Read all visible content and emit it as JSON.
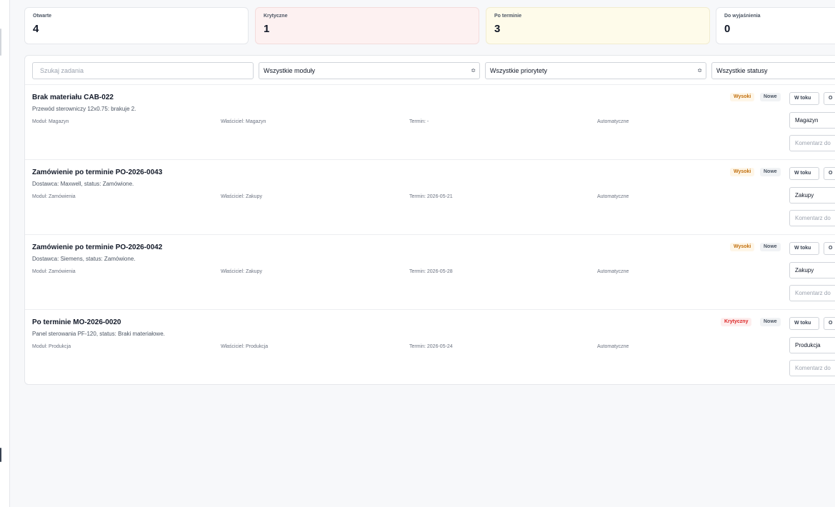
{
  "stats": [
    {
      "label": "Otwarte",
      "value": "4"
    },
    {
      "label": "Krytyczne",
      "value": "1"
    },
    {
      "label": "Po terminie",
      "value": "3"
    },
    {
      "label": "Do wyjaśnienia",
      "value": "0"
    }
  ],
  "filters": {
    "search_placeholder": "Szukaj zadania",
    "module": "Wszystkie moduły",
    "priority": "Wszystkie priorytety",
    "status": "Wszystkie statusy",
    "arrows": "≎"
  },
  "tasks": [
    {
      "title": "Brak materiału CAB-022",
      "description": "Przewód sterowniczy 12x0.75: brakuje 2.",
      "module": "Moduł: Magazyn",
      "owner": "Właściciel: Magazyn",
      "deadline": "Termin: -",
      "source": "Automatyczne",
      "priority": "Wysoki",
      "status": "Nowe",
      "btn_progress": "W toku",
      "btn_other": "O",
      "owner_select": "Magazyn",
      "comment_placeholder": "Komentarz do"
    },
    {
      "title": "Zamówienie po terminie PO-2026-0043",
      "description": "Dostawca: Maxwell, status: Zamówione.",
      "module": "Moduł: Zamówienia",
      "owner": "Właściciel: Zakupy",
      "deadline": "Termin: 2026-05-21",
      "source": "Automatyczne",
      "priority": "Wysoki",
      "status": "Nowe",
      "btn_progress": "W toku",
      "btn_other": "O",
      "owner_select": "Zakupy",
      "comment_placeholder": "Komentarz do"
    },
    {
      "title": "Zamówienie po terminie PO-2026-0042",
      "description": "Dostawca: Siemens, status: Zamówione.",
      "module": "Moduł: Zamówienia",
      "owner": "Właściciel: Zakupy",
      "deadline": "Termin: 2026-05-28",
      "source": "Automatyczne",
      "priority": "Wysoki",
      "status": "Nowe",
      "btn_progress": "W toku",
      "btn_other": "O",
      "owner_select": "Zakupy",
      "comment_placeholder": "Komentarz do"
    },
    {
      "title": "Po terminie MO-2026-0020",
      "description": "Panel sterowania PF-120, status: Braki materiałowe.",
      "module": "Moduł: Produkcja",
      "owner": "Właściciel: Produkcja",
      "deadline": "Termin: 2026-05-24",
      "source": "Automatyczne",
      "priority": "Krytyczny",
      "status": "Nowe",
      "btn_progress": "W toku",
      "btn_other": "O",
      "owner_select": "Produkcja",
      "comment_placeholder": "Komentarz do"
    }
  ]
}
